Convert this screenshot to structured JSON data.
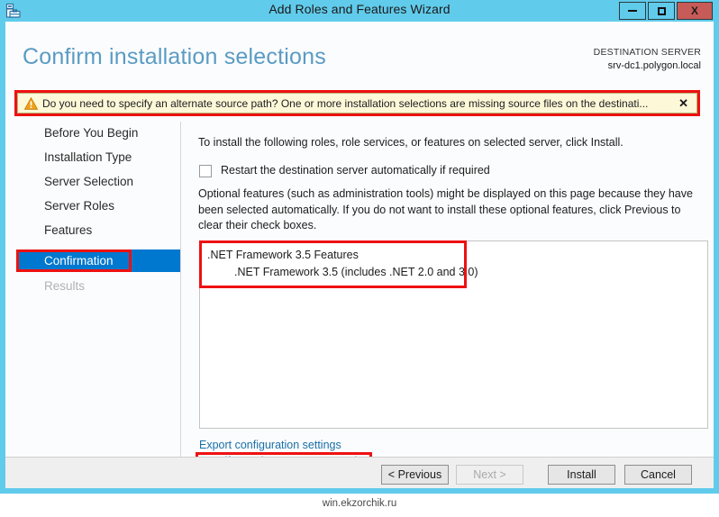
{
  "window": {
    "title": "Add Roles and Features Wizard",
    "app_icon": "server-manager-icon",
    "minimize_label": "",
    "maximize_label": "",
    "close_label": "X",
    "frame_color": "#61cbeb",
    "close_button_color": "#c75b57"
  },
  "header": {
    "page_title": "Confirm installation selections",
    "page_title_color": "#5a9bc4",
    "destination_label": "DESTINATION SERVER",
    "destination_server": "srv-dc1.polygon.local"
  },
  "warning": {
    "icon": "warning-triangle-icon",
    "text": "Do you need to specify an alternate source path? One or more installation selections are missing source files on the destinati...",
    "close_label": "✕",
    "background_color": "#fdf8d8",
    "annotation_color": "#ee1111"
  },
  "sidebar": {
    "items": [
      {
        "label": "Before You Begin",
        "state": "normal"
      },
      {
        "label": "Installation Type",
        "state": "normal"
      },
      {
        "label": "Server Selection",
        "state": "normal"
      },
      {
        "label": "Server Roles",
        "state": "normal"
      },
      {
        "label": "Features",
        "state": "normal"
      },
      {
        "label": "Confirmation",
        "state": "selected"
      },
      {
        "label": "Results",
        "state": "disabled"
      }
    ],
    "selected_color": "#0078cf"
  },
  "main": {
    "intro_text": "To install the following roles, role services, or features on selected server, click Install.",
    "restart_label": "Restart the destination server automatically if required",
    "restart_checked": false,
    "optional_text": "Optional features (such as administration tools) might be displayed on this page because they have been selected automatically. If you do not want to install these optional features, click Previous to clear their check boxes.",
    "features": [
      {
        "label": ".NET Framework 3.5 Features",
        "indent": false
      },
      {
        "label": ".NET Framework 3.5 (includes .NET 2.0 and 3.0)",
        "indent": true
      }
    ],
    "links": [
      {
        "label": "Export configuration settings"
      },
      {
        "label": "Specify an alternate source path"
      }
    ],
    "link_color": "#1a6fa8"
  },
  "footer": {
    "buttons": [
      {
        "label": "< Previous",
        "enabled": true
      },
      {
        "label": "Next >",
        "enabled": false
      },
      {
        "label": "Install",
        "enabled": true
      },
      {
        "label": "Cancel",
        "enabled": true
      }
    ]
  },
  "watermark": {
    "text": "win.ekzorchik.ru"
  }
}
